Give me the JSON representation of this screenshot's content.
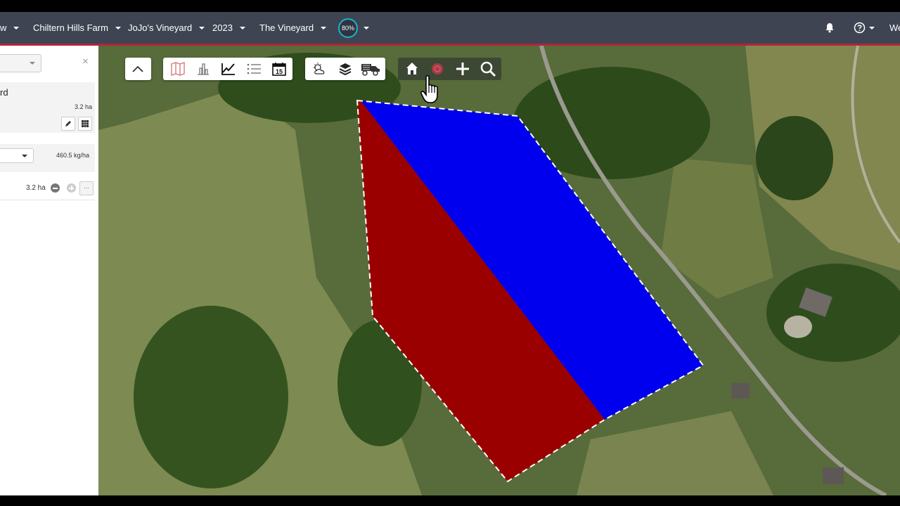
{
  "nav": {
    "items": [
      {
        "label": "w"
      },
      {
        "label": "Chiltern Hills Farm"
      },
      {
        "label": "JoJo's Vineyard"
      },
      {
        "label": "2023"
      },
      {
        "label": "The Vineyard"
      }
    ],
    "progress": "80%",
    "progress_value": 0.8,
    "user_label": "We"
  },
  "panel": {
    "close": "×",
    "title": "rd",
    "area_top": "3.2 ha",
    "rate": "460.5 kg/ha",
    "zone_area": "3.2 ha",
    "more": "..."
  },
  "map": {
    "zone_colors": {
      "high": "#0000ee",
      "low": "#9b0000"
    }
  },
  "toolbar": {
    "groups": [
      [
        "chevron-up-icon"
      ],
      [
        "map-icon",
        "bar-chart-icon",
        "line-chart-icon",
        "list-icon",
        "calendar-icon"
      ],
      [
        "weather-icon",
        "layers-icon",
        "machinery-icon"
      ],
      [
        "home-icon",
        "target-icon",
        "plus-icon",
        "search-icon"
      ]
    ],
    "calendar_day": "15"
  }
}
